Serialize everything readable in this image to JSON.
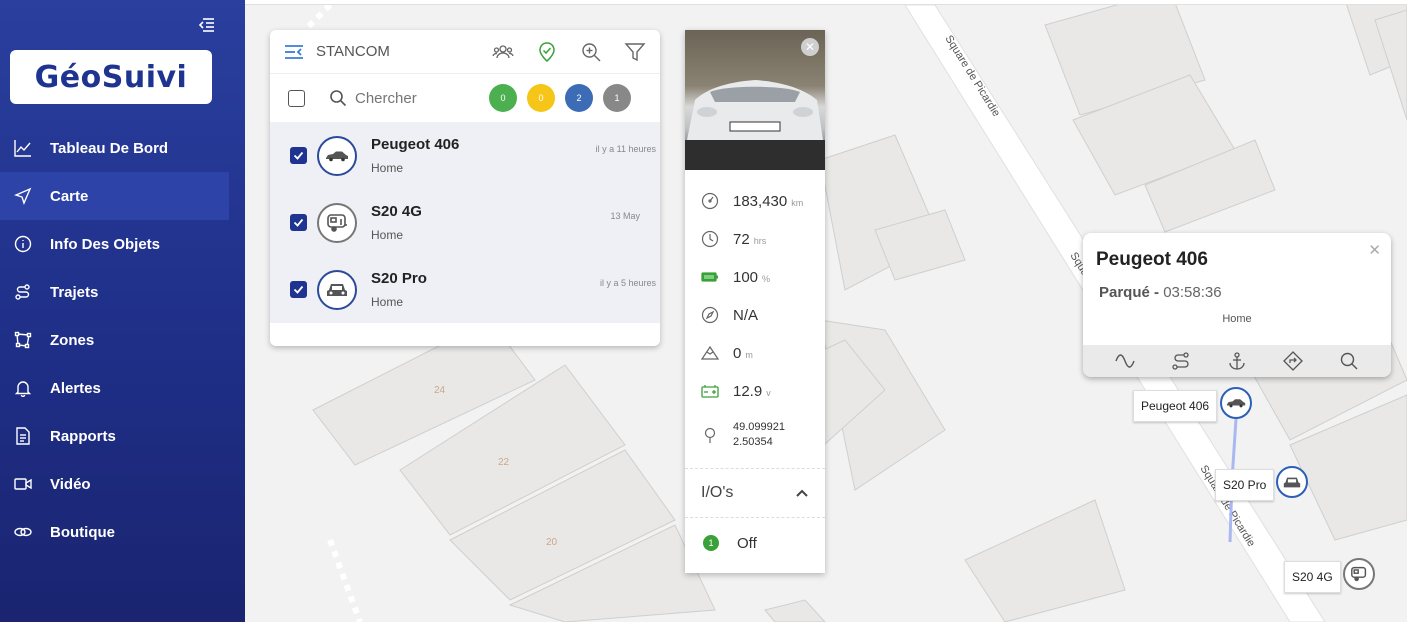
{
  "app": {
    "logo_text": "GéoSuivi"
  },
  "sidebar": {
    "items": [
      {
        "label": "Tableau De Bord",
        "icon": "chart-line-icon"
      },
      {
        "label": "Carte",
        "icon": "navigation-arrow-icon"
      },
      {
        "label": "Info Des Objets",
        "icon": "info-icon"
      },
      {
        "label": "Trajets",
        "icon": "route-icon"
      },
      {
        "label": "Zones",
        "icon": "polygon-icon"
      },
      {
        "label": "Alertes",
        "icon": "bell-icon"
      },
      {
        "label": "Rapports",
        "icon": "document-icon"
      },
      {
        "label": "Vidéo",
        "icon": "video-icon"
      },
      {
        "label": "Boutique",
        "icon": "cart-icon"
      }
    ],
    "active": "Carte"
  },
  "objects_panel": {
    "title": "STANCOM",
    "search_placeholder": "Chercher",
    "counts": [
      {
        "value": "0",
        "color": "#4caf50"
      },
      {
        "value": "0",
        "color": "#f5c518"
      },
      {
        "value": "2",
        "color": "#3b6cb5"
      },
      {
        "value": "1",
        "color": "#888888"
      }
    ],
    "items": [
      {
        "name": "Peugeot 406",
        "location": "Home",
        "time": "il y a 11 heures",
        "icon": "sedan-icon"
      },
      {
        "name": "S20 4G",
        "location": "Home",
        "time": "13 May",
        "icon": "trailer-icon"
      },
      {
        "name": "S20 Pro",
        "location": "Home",
        "time": "il y a 5 heures",
        "icon": "car-front-icon"
      }
    ]
  },
  "details": {
    "odometer": {
      "value": "183,430",
      "unit": "km"
    },
    "engine_hours": {
      "value": "72",
      "unit": "hrs"
    },
    "battery": {
      "value": "100",
      "unit": "%"
    },
    "heading": {
      "value": "N/A"
    },
    "altitude": {
      "value": "0",
      "unit": "m"
    },
    "voltage": {
      "value": "12.9",
      "unit": "v"
    },
    "lat": "49.099921",
    "lng": "2.50354",
    "io_title": "I/O's",
    "io_index": "1",
    "io_value": "Off"
  },
  "popup": {
    "title": "Peugeot 406",
    "status": "Parqué",
    "duration": "03:58:36",
    "location": "Home"
  },
  "map": {
    "street_name": "Square de Picardie",
    "street_name_partial": "Squa",
    "building_numbers": [
      "24",
      "22",
      "20"
    ],
    "markers": [
      {
        "label": "Peugeot 406"
      },
      {
        "label": "S20 Pro"
      },
      {
        "label": "S20 4G"
      }
    ]
  }
}
